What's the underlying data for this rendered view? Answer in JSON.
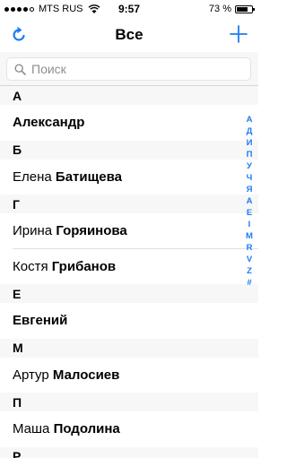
{
  "status_bar": {
    "carrier": "MTS RUS",
    "time": "9:57",
    "battery_text": "73 %",
    "battery_level": 0.73
  },
  "nav": {
    "title": "Все",
    "left_icon": "refresh-icon",
    "right_icon": "plus-icon"
  },
  "search": {
    "placeholder": "Поиск",
    "value": ""
  },
  "sections": [
    {
      "header": "А",
      "contacts": [
        {
          "first": "",
          "last": "Александр"
        }
      ]
    },
    {
      "header": "Б",
      "contacts": [
        {
          "first": "Елена",
          "last": "Батищева"
        }
      ]
    },
    {
      "header": "Г",
      "contacts": [
        {
          "first": "Ирина",
          "last": "Горяинова"
        },
        {
          "first": "Костя",
          "last": "Грибанов"
        }
      ]
    },
    {
      "header": "Е",
      "contacts": [
        {
          "first": "",
          "last": "Евгений"
        }
      ]
    },
    {
      "header": "М",
      "contacts": [
        {
          "first": "Артур",
          "last": "Малосиев"
        }
      ]
    },
    {
      "header": "П",
      "contacts": [
        {
          "first": "Маша",
          "last": "Подолина"
        }
      ]
    },
    {
      "header": "Р",
      "contacts": []
    }
  ],
  "index_letters": [
    "А",
    "Д",
    "И",
    "П",
    "У",
    "Ч",
    "Я",
    "A",
    "E",
    "I",
    "M",
    "R",
    "V",
    "Z",
    "#"
  ],
  "colors": {
    "accent": "#1b7cf4",
    "section_bg": "#f7f7f7"
  }
}
